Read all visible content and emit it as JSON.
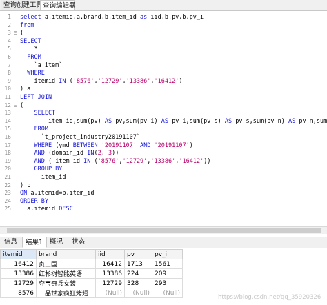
{
  "tabs": [
    "查询创建工具",
    "查询编辑器"
  ],
  "editor": {
    "lines": [
      {
        "n": "1",
        "fold": "",
        "tokens": [
          [
            "kw",
            "select "
          ],
          [
            "pl",
            "a.itemid,a.brand,b.item_id "
          ],
          [
            "kw",
            "as "
          ],
          [
            "pl",
            "iid,b.pv,b.pv_i"
          ]
        ]
      },
      {
        "n": "2",
        "fold": "",
        "tokens": [
          [
            "kw",
            "from"
          ]
        ]
      },
      {
        "n": "3",
        "fold": "⊟",
        "tokens": [
          [
            "pl",
            "("
          ]
        ]
      },
      {
        "n": "4",
        "fold": "",
        "tokens": [
          [
            "kw",
            "SELECT"
          ]
        ]
      },
      {
        "n": "5",
        "fold": "",
        "tokens": [
          [
            "pl",
            "    *"
          ]
        ]
      },
      {
        "n": "6",
        "fold": "",
        "tokens": [
          [
            "kw",
            "  FROM"
          ]
        ]
      },
      {
        "n": "7",
        "fold": "",
        "tokens": [
          [
            "pl",
            "    `a_item`"
          ]
        ]
      },
      {
        "n": "8",
        "fold": "",
        "tokens": [
          [
            "kw",
            "  WHERE"
          ]
        ]
      },
      {
        "n": "9",
        "fold": "",
        "tokens": [
          [
            "pl",
            "    itemid "
          ],
          [
            "kw",
            "IN "
          ],
          [
            "pl",
            "("
          ],
          [
            "str",
            "'8576'"
          ],
          [
            "pl",
            ","
          ],
          [
            "str",
            "'12729'"
          ],
          [
            "pl",
            ","
          ],
          [
            "str",
            "'13386'"
          ],
          [
            "pl",
            ","
          ],
          [
            "str",
            "'16412'"
          ],
          [
            "pl",
            ")"
          ]
        ]
      },
      {
        "n": "10",
        "fold": "",
        "tokens": [
          [
            "pl",
            ") a"
          ]
        ]
      },
      {
        "n": "11",
        "fold": "",
        "tokens": [
          [
            "kw",
            "LEFT JOIN"
          ]
        ]
      },
      {
        "n": "12",
        "fold": "⊟",
        "tokens": [
          [
            "pl",
            "("
          ]
        ]
      },
      {
        "n": "13",
        "fold": "",
        "tokens": [
          [
            "kw",
            "    SELECT"
          ]
        ]
      },
      {
        "n": "14",
        "fold": "",
        "tokens": [
          [
            "pl",
            "        item_id,sum(pv) "
          ],
          [
            "kw",
            "AS "
          ],
          [
            "pl",
            "pv,sum(pv_i) "
          ],
          [
            "kw",
            "AS "
          ],
          [
            "pl",
            "pv_i,sum(pv_s) "
          ],
          [
            "kw",
            "AS "
          ],
          [
            "pl",
            "pv_s,sum(pv_n) "
          ],
          [
            "kw",
            "AS "
          ],
          [
            "pl",
            "pv_n,sum(pv_h"
          ]
        ]
      },
      {
        "n": "15",
        "fold": "",
        "tokens": [
          [
            "kw",
            "    FROM"
          ]
        ]
      },
      {
        "n": "16",
        "fold": "",
        "tokens": [
          [
            "pl",
            "      `t_project_industry20191107`"
          ]
        ]
      },
      {
        "n": "17",
        "fold": "",
        "tokens": [
          [
            "kw",
            "    WHERE "
          ],
          [
            "pl",
            "(ymd "
          ],
          [
            "kw",
            "BETWEEN "
          ],
          [
            "str",
            "'20191107' "
          ],
          [
            "kw",
            "AND "
          ],
          [
            "str",
            "'20191107'"
          ],
          [
            "pl",
            ")"
          ]
        ]
      },
      {
        "n": "18",
        "fold": "",
        "tokens": [
          [
            "kw",
            "    AND "
          ],
          [
            "pl",
            "(domain_id "
          ],
          [
            "kw",
            "IN"
          ],
          [
            "pl",
            "("
          ],
          [
            "num",
            "2"
          ],
          [
            "pl",
            ", "
          ],
          [
            "num",
            "3"
          ],
          [
            "pl",
            "))"
          ]
        ]
      },
      {
        "n": "19",
        "fold": "",
        "tokens": [
          [
            "kw",
            "    AND "
          ],
          [
            "pl",
            "( item_id "
          ],
          [
            "kw",
            "IN "
          ],
          [
            "pl",
            "("
          ],
          [
            "str",
            "'8576'"
          ],
          [
            "pl",
            ","
          ],
          [
            "str",
            "'12729'"
          ],
          [
            "pl",
            ","
          ],
          [
            "str",
            "'13386'"
          ],
          [
            "pl",
            ","
          ],
          [
            "str",
            "'16412'"
          ],
          [
            "pl",
            "))"
          ]
        ]
      },
      {
        "n": "20",
        "fold": "",
        "tokens": [
          [
            "kw",
            "    GROUP BY"
          ]
        ]
      },
      {
        "n": "21",
        "fold": "",
        "tokens": [
          [
            "pl",
            "      item_id"
          ]
        ]
      },
      {
        "n": "22",
        "fold": "",
        "tokens": [
          [
            "pl",
            ") b"
          ]
        ]
      },
      {
        "n": "23",
        "fold": "",
        "tokens": [
          [
            "kw",
            "ON "
          ],
          [
            "pl",
            "a.itemid=b.item_id"
          ]
        ]
      },
      {
        "n": "24",
        "fold": "",
        "tokens": [
          [
            "kw",
            "ORDER BY"
          ]
        ]
      },
      {
        "n": "25",
        "fold": "",
        "tokens": [
          [
            "pl",
            "  a.itemid "
          ],
          [
            "kw",
            "DESC"
          ]
        ]
      }
    ]
  },
  "result_tabs": [
    "信息",
    "结果1",
    "概况",
    "状态"
  ],
  "grid": {
    "columns": [
      "itemid",
      "brand",
      "iid",
      "pv",
      "pv_i"
    ],
    "rows": [
      [
        "16412",
        "贞三国",
        "16412",
        "1713",
        "1561"
      ],
      [
        "13386",
        "红杉树智能英语",
        "13386",
        "224",
        "209"
      ],
      [
        "12729",
        "夺宝奇兵女装",
        "12729",
        "328",
        "293"
      ],
      [
        "8576",
        "一品世家疯狂烤翅",
        "(Null)",
        "(Null)",
        "(Null)"
      ]
    ]
  },
  "watermark": "https://blog.csdn.net/qq_35920326"
}
